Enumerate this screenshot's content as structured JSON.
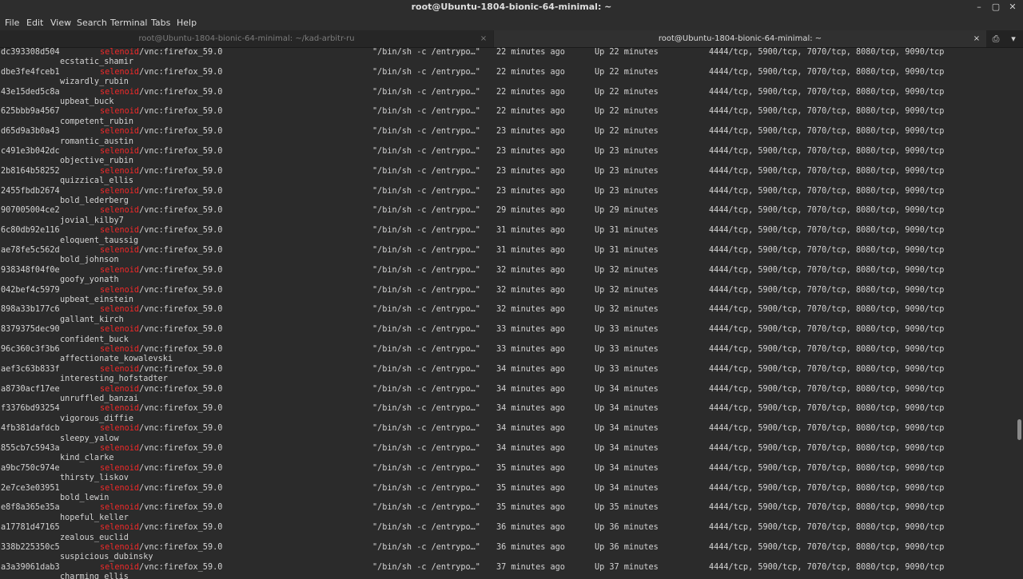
{
  "window": {
    "title": "root@Ubuntu-1804-bionic-64-minimal: ~",
    "minimize": "–",
    "maximize": "▢",
    "close": "✕"
  },
  "menu": [
    "File",
    "Edit",
    "View",
    "Search",
    "Terminal",
    "Tabs",
    "Help"
  ],
  "tabs": [
    {
      "title": "root@Ubuntu-1804-bionic-64-minimal: ~/kad-arbitr-ru",
      "active": false
    },
    {
      "title": "root@Ubuntu-1804-bionic-64-minimal: ~",
      "active": true
    }
  ],
  "tab_close": "×",
  "tab_actions": {
    "new_tab": "⎙",
    "menu": "▾"
  },
  "common": {
    "image_prefix": "selenoid",
    "image_suffix": "/vnc:firefox_59.0",
    "command": "\"/bin/sh -c /entrypo…\"",
    "ports": "4444/tcp, 5900/tcp, 7070/tcp, 8080/tcp, 9090/tcp"
  },
  "containers": [
    {
      "id": "dc393308d504",
      "created": "22 minutes ago",
      "status": "Up 22 minutes",
      "name": "ecstatic_shamir"
    },
    {
      "id": "dbe3fe4fceb1",
      "created": "22 minutes ago",
      "status": "Up 22 minutes",
      "name": "wizardly_rubin"
    },
    {
      "id": "43e15ded5c8a",
      "created": "22 minutes ago",
      "status": "Up 22 minutes",
      "name": "upbeat_buck"
    },
    {
      "id": "625bbb9a4567",
      "created": "22 minutes ago",
      "status": "Up 22 minutes",
      "name": "competent_rubin"
    },
    {
      "id": "d65d9a3b0a43",
      "created": "23 minutes ago",
      "status": "Up 22 minutes",
      "name": "romantic_austin"
    },
    {
      "id": "c491e3b042dc",
      "created": "23 minutes ago",
      "status": "Up 23 minutes",
      "name": "objective_rubin"
    },
    {
      "id": "2b8164b58252",
      "created": "23 minutes ago",
      "status": "Up 23 minutes",
      "name": "quizzical_ellis"
    },
    {
      "id": "2455fbdb2674",
      "created": "23 minutes ago",
      "status": "Up 23 minutes",
      "name": "bold_lederberg"
    },
    {
      "id": "907005004ce2",
      "created": "29 minutes ago",
      "status": "Up 29 minutes",
      "name": "jovial_kilby7"
    },
    {
      "id": "6c80db92e116",
      "created": "31 minutes ago",
      "status": "Up 31 minutes",
      "name": "eloquent_taussig"
    },
    {
      "id": "ae78fe5c562d",
      "created": "31 minutes ago",
      "status": "Up 31 minutes",
      "name": "bold_johnson"
    },
    {
      "id": "938348f04f0e",
      "created": "32 minutes ago",
      "status": "Up 32 minutes",
      "name": "goofy_yonath"
    },
    {
      "id": "042bef4c5979",
      "created": "32 minutes ago",
      "status": "Up 32 minutes",
      "name": "upbeat_einstein"
    },
    {
      "id": "898a33b177c6",
      "created": "32 minutes ago",
      "status": "Up 32 minutes",
      "name": "gallant_kirch"
    },
    {
      "id": "8379375dec90",
      "created": "33 minutes ago",
      "status": "Up 33 minutes",
      "name": "confident_buck"
    },
    {
      "id": "96c360c3f3b6",
      "created": "33 minutes ago",
      "status": "Up 33 minutes",
      "name": "affectionate_kowalevski"
    },
    {
      "id": "aef3c63b833f",
      "created": "34 minutes ago",
      "status": "Up 33 minutes",
      "name": "interesting_hofstadter"
    },
    {
      "id": "a8730acf17ee",
      "created": "34 minutes ago",
      "status": "Up 34 minutes",
      "name": "unruffled_banzai"
    },
    {
      "id": "f3376bd93254",
      "created": "34 minutes ago",
      "status": "Up 34 minutes",
      "name": "vigorous_diffie"
    },
    {
      "id": "4fb381dafdcb",
      "created": "34 minutes ago",
      "status": "Up 34 minutes",
      "name": "sleepy_yalow"
    },
    {
      "id": "855cb7c5943a",
      "created": "34 minutes ago",
      "status": "Up 34 minutes",
      "name": "kind_clarke"
    },
    {
      "id": "a9bc750c974e",
      "created": "35 minutes ago",
      "status": "Up 34 minutes",
      "name": "thirsty_liskov"
    },
    {
      "id": "2e7ce3e03951",
      "created": "35 minutes ago",
      "status": "Up 34 minutes",
      "name": "bold_lewin"
    },
    {
      "id": "e8f8a365e35a",
      "created": "35 minutes ago",
      "status": "Up 35 minutes",
      "name": "hopeful_keller"
    },
    {
      "id": "a17781d47165",
      "created": "36 minutes ago",
      "status": "Up 36 minutes",
      "name": "zealous_euclid"
    },
    {
      "id": "338b225350c5",
      "created": "36 minutes ago",
      "status": "Up 36 minutes",
      "name": "suspicious_dubinsky"
    },
    {
      "id": "a3a39061dab3",
      "created": "37 minutes ago",
      "status": "Up 37 minutes",
      "name": "charming_ellis"
    }
  ]
}
